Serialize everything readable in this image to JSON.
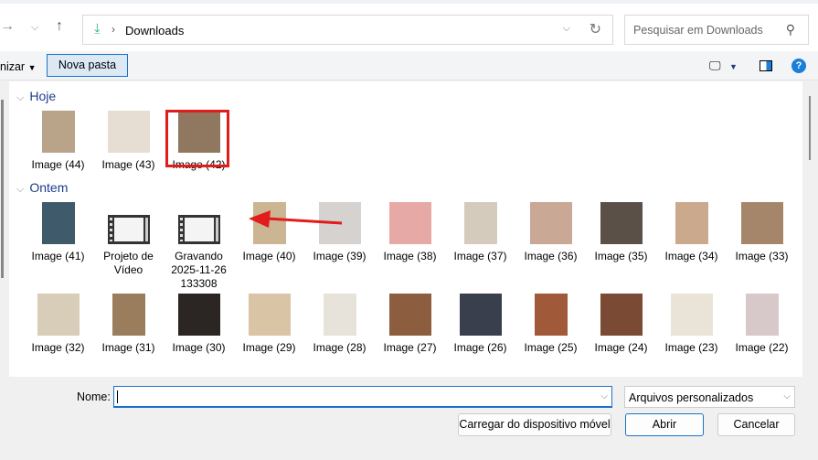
{
  "address": {
    "folder": "Downloads",
    "search_placeholder": "Pesquisar em Downloads"
  },
  "toolbar": {
    "organize_label": "nizar",
    "new_folder_label": "Nova pasta",
    "help": "?"
  },
  "groups": [
    {
      "label": "Hoje",
      "items": [
        {
          "label": "Image (44)",
          "color": "#b9a48a",
          "type": "image"
        },
        {
          "label": "Image (43)",
          "color": "#e6ded3",
          "type": "image"
        },
        {
          "label": "Image (42)",
          "color": "#8f7760",
          "type": "image",
          "selected": true
        }
      ]
    },
    {
      "label": "Ontem",
      "items": [
        {
          "label": "Image (41)",
          "color": "#3e5a6b",
          "type": "image"
        },
        {
          "label": "Projeto de Vídeo",
          "type": "video"
        },
        {
          "label": "Gravando 2025-11-26 133308",
          "type": "video"
        },
        {
          "label": "Image (40)",
          "color": "#cbb592",
          "type": "image"
        },
        {
          "label": "Image (39)",
          "color": "#d6d2cf",
          "type": "image"
        },
        {
          "label": "Image (38)",
          "color": "#e7a9a6",
          "type": "image"
        },
        {
          "label": "Image (37)",
          "color": "#d5cbbd",
          "type": "image"
        },
        {
          "label": "Image (36)",
          "color": "#c9a896",
          "type": "image"
        },
        {
          "label": "Image (35)",
          "color": "#5a5048",
          "type": "image"
        },
        {
          "label": "Image (34)",
          "color": "#caa98c",
          "type": "image"
        },
        {
          "label": "Image (33)",
          "color": "#a6866a",
          "type": "image"
        },
        {
          "label": "Image (32)",
          "color": "#d8cdb8",
          "type": "image"
        },
        {
          "label": "Image (31)",
          "color": "#9a7d5c",
          "type": "image"
        },
        {
          "label": "Image (30)",
          "color": "#2b2623",
          "type": "image"
        },
        {
          "label": "Image (29)",
          "color": "#d9c4a6",
          "type": "image"
        },
        {
          "label": "Image (28)",
          "color": "#e8e3da",
          "type": "image"
        },
        {
          "label": "Image (27)",
          "color": "#8c5d3e",
          "type": "image"
        },
        {
          "label": "Image (26)",
          "color": "#3a3f4d",
          "type": "image"
        },
        {
          "label": "Image (25)",
          "color": "#a05a3a",
          "type": "image"
        },
        {
          "label": "Image (24)",
          "color": "#7a4a34",
          "type": "image"
        },
        {
          "label": "Image (23)",
          "color": "#e9e3d8",
          "type": "image"
        },
        {
          "label": "Image (22)",
          "color": "#d7c9c9",
          "type": "image"
        },
        {
          "label": "",
          "color": "#d9c6aa",
          "type": "image"
        },
        {
          "label": "",
          "color": "#3a2c22",
          "type": "image"
        },
        {
          "label": "",
          "color": "#d9b870",
          "type": "image"
        },
        {
          "label": "",
          "color": "#4a3a2c",
          "type": "image"
        },
        {
          "label": "",
          "color": "#8a1e1e",
          "type": "image"
        },
        {
          "label": "",
          "color": "#c19a72",
          "type": "image"
        }
      ]
    }
  ],
  "footer": {
    "name_label": "Nome:",
    "name_value": "",
    "file_type": "Arquivos personalizados",
    "mobile_button": "Carregar do dispositivo móvel",
    "open_button": "Abrir",
    "cancel_button": "Cancelar"
  },
  "annotation_color": "#e11c1c"
}
